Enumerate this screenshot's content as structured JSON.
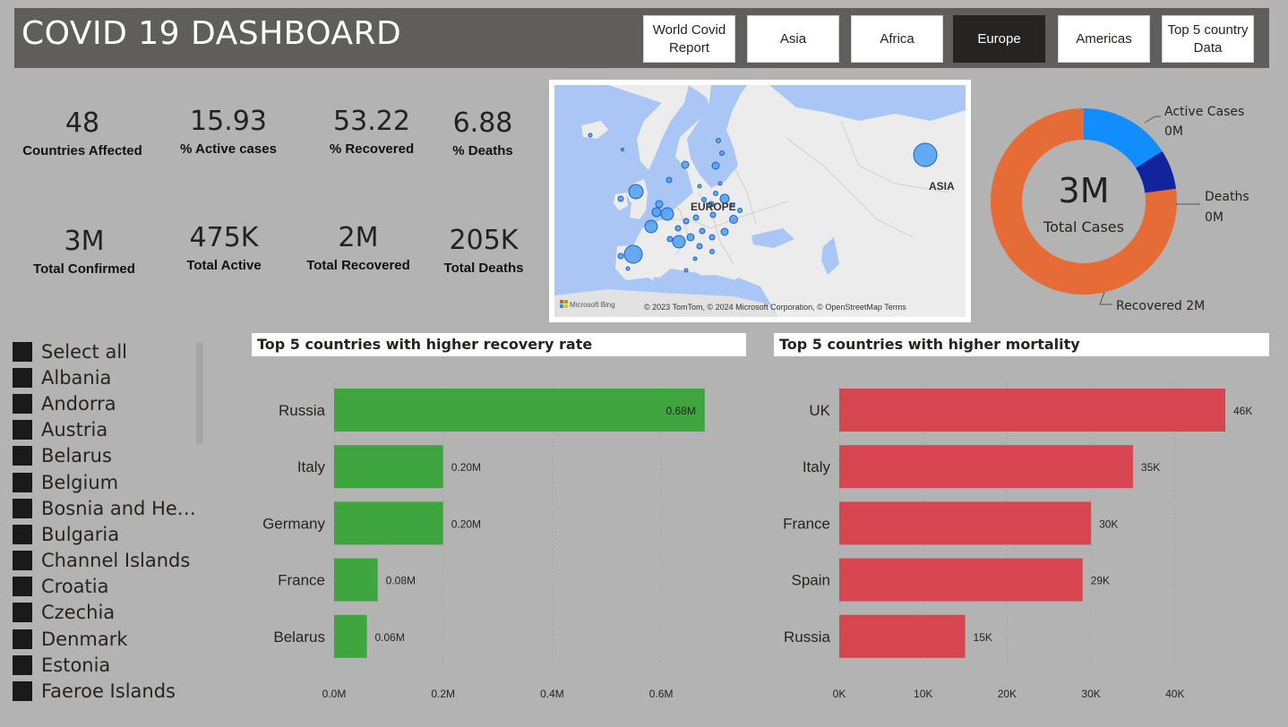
{
  "header": {
    "title": "COVID 19 DASHBOARD",
    "nav": [
      {
        "label": "World Covid\nReport",
        "active": false
      },
      {
        "label": "Asia",
        "active": false
      },
      {
        "label": "Africa",
        "active": false
      },
      {
        "label": "Europe",
        "active": true
      },
      {
        "label": "Americas",
        "active": false
      },
      {
        "label": "Top 5 country\nData",
        "active": false
      }
    ]
  },
  "kpis": {
    "countries_affected": {
      "value": "48",
      "label": "Countries Affected"
    },
    "pct_active": {
      "value": "15.93",
      "label": "% Active cases"
    },
    "pct_recovered": {
      "value": "53.22",
      "label": "% Recovered"
    },
    "pct_deaths": {
      "value": "6.88",
      "label": "% Deaths"
    },
    "total_confirmed": {
      "value": "3M",
      "label": "Total Confirmed"
    },
    "total_active": {
      "value": "475K",
      "label": "Total Active"
    },
    "total_recovered": {
      "value": "2M",
      "label": "Total Recovered"
    },
    "total_deaths": {
      "value": "205K",
      "label": "Total Deaths"
    }
  },
  "map": {
    "labels": [
      "EUROPE",
      "ASIA"
    ],
    "logo": "Microsoft Bing",
    "attribution": "© 2023 TomTom, © 2024 Microsoft Corporation, © OpenStreetMap  Terms",
    "colors": {
      "water": "#a9c6f4",
      "land": "#ececec",
      "bubble": "#4a9ff5"
    }
  },
  "donut": {
    "center_value": "3M",
    "center_label": "Total Cases",
    "segments": [
      {
        "name": "Active Cases",
        "value_label": "0M",
        "share": 0.1593,
        "color": "#118dff"
      },
      {
        "name": "Deaths",
        "value_label": "0M",
        "share": 0.0688,
        "color": "#12239e"
      },
      {
        "name": "Recovered",
        "value_label": "2M",
        "share": 0.7719,
        "color": "#e66c37"
      }
    ],
    "recovered_label": "Recovered 2M"
  },
  "slicer": {
    "items": [
      "Select all",
      "Albania",
      "Andorra",
      "Austria",
      "Belarus",
      "Belgium",
      "Bosnia and Herz...",
      "Bulgaria",
      "Channel Islands",
      "Croatia",
      "Czechia",
      "Denmark",
      "Estonia",
      "Faeroe Islands"
    ]
  },
  "chart_data": [
    {
      "type": "bar",
      "orientation": "horizontal",
      "title": "Top 5 countries with higher recovery rate",
      "categories": [
        "Russia",
        "Italy",
        "Germany",
        "France",
        "Belarus"
      ],
      "values": [
        0.68,
        0.2,
        0.2,
        0.08,
        0.06
      ],
      "data_labels": [
        "0.68M",
        "0.20M",
        "0.20M",
        "0.08M",
        "0.06M"
      ],
      "xticks": [
        "0.0M",
        "0.2M",
        "0.4M",
        "0.6M"
      ],
      "xlim": [
        0,
        0.7
      ],
      "color": "#3fa63f"
    },
    {
      "type": "bar",
      "orientation": "horizontal",
      "title": "Top 5 countries with higher mortality",
      "categories": [
        "UK",
        "Italy",
        "France",
        "Spain",
        "Russia"
      ],
      "values": [
        46,
        35,
        30,
        29,
        15
      ],
      "data_labels": [
        "46K",
        "35K",
        "30K",
        "29K",
        "15K"
      ],
      "xticks": [
        "0K",
        "10K",
        "20K",
        "30K",
        "40K"
      ],
      "xlim": [
        0,
        46
      ],
      "color": "#d64550"
    }
  ]
}
